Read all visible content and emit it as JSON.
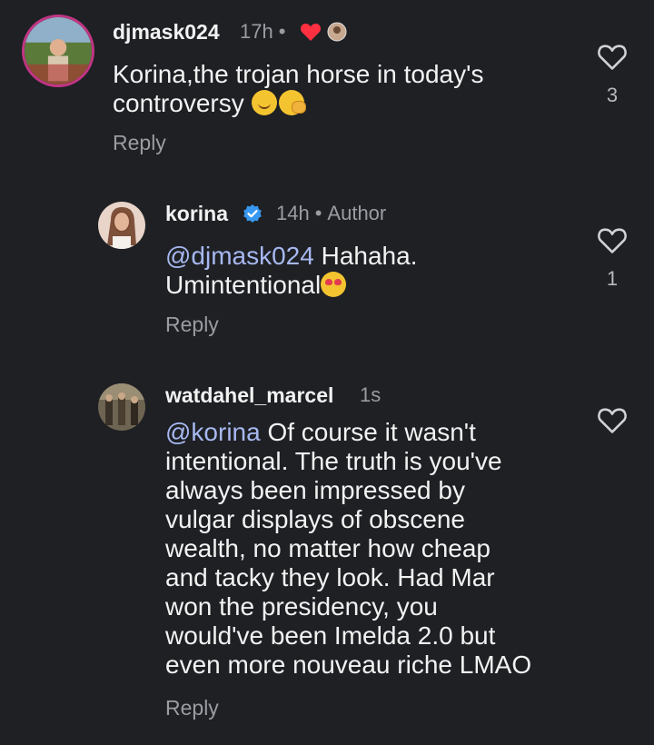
{
  "comments": [
    {
      "username": "djmask024",
      "time": "17h",
      "dot": "•",
      "text": "Korina,the trojan horse in today's controversy",
      "reply": "Reply",
      "likes": "3"
    },
    {
      "username": "korina",
      "time": "14h",
      "dot": "•",
      "author_tag": "Author",
      "mention": "@djmask024",
      "text_line1": " Hahaha.",
      "text_line2": "Umintentional",
      "reply": "Reply",
      "likes": "1"
    },
    {
      "username": "watdahel_marcel",
      "time": "1s",
      "mention": "@korina",
      "text_lines": [
        " Of course it wasn't",
        "intentional. The truth is you've",
        "always been impressed by",
        "vulgar displays of obscene",
        "wealth, no matter how cheap",
        "and tacky they look. Had Mar",
        "won the presidency, you",
        "would've been Imelda 2.0 but",
        "even more nouveau riche LMAO"
      ],
      "reply": "Reply"
    }
  ],
  "icons": {
    "like": "heart-outline-icon",
    "author_liked": "red-heart-icon",
    "verified": "verified-badge-icon"
  },
  "colors": {
    "background": "#1e2024",
    "mention": "#a7b8f0",
    "muted": "#9a9ca2",
    "red_heart": "#ff3040",
    "verified": "#3897f0"
  }
}
